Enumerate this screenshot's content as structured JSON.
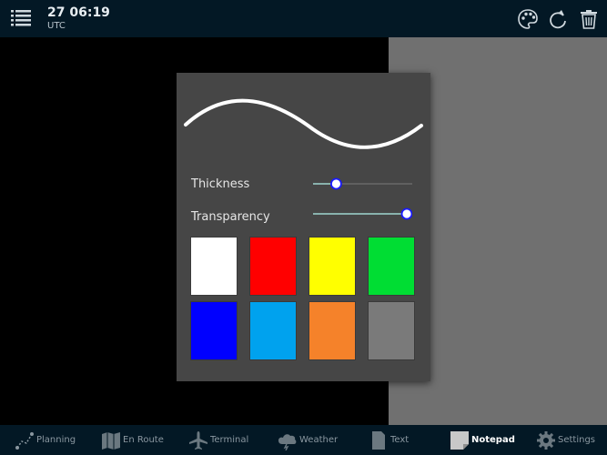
{
  "header": {
    "time": "27 06:19",
    "timezone": "UTC",
    "icons": [
      "menu-icon",
      "palette-icon",
      "redo-icon",
      "trash-icon"
    ]
  },
  "popup": {
    "thickness_label": "Thickness",
    "transparency_label": "Transparency",
    "thickness_value": 0.2,
    "transparency_value": 1.0,
    "stroke_color": "#ffffff",
    "colors": [
      "#ffffff",
      "#ff0000",
      "#ffff00",
      "#00dd33",
      "#0000ff",
      "#00a2ee",
      "#f5822a",
      "#7a7a7a"
    ]
  },
  "nav": {
    "items": [
      {
        "label": "Planning",
        "icon": "planning-icon"
      },
      {
        "label": "En Route",
        "icon": "map-icon"
      },
      {
        "label": "Terminal",
        "icon": "airplane-icon"
      },
      {
        "label": "Weather",
        "icon": "cloud-icon"
      },
      {
        "label": "Text",
        "icon": "document-icon"
      },
      {
        "label": "Notepad",
        "icon": "notepad-icon",
        "active": true
      },
      {
        "label": "Settings",
        "icon": "gear-icon"
      }
    ]
  },
  "colors": {
    "bar_background": "#031825",
    "slider_accent": "#1a1aff",
    "slider_track_active": "#9fd6cf"
  }
}
